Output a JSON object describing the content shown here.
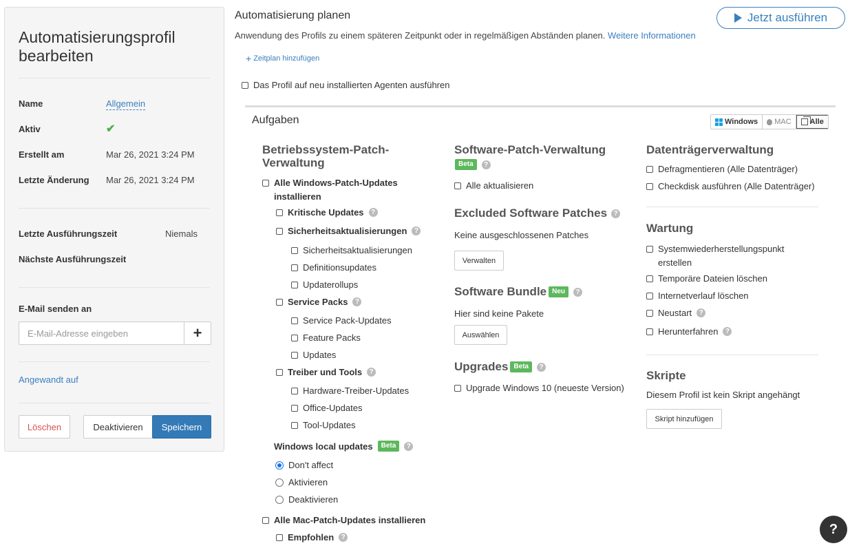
{
  "profile": {
    "title": "Automatisierungsprofil bearbeiten",
    "name_label": "Name",
    "name_value": "Allgemein",
    "active_label": "Aktiv",
    "active_mark": "✔",
    "created_label": "Erstellt am",
    "created_value": "Mar 26, 2021 3:24 PM",
    "modified_label": "Letzte Änderung",
    "modified_value": "Mar 26, 2021 3:24 PM",
    "last_run_label": "Letzte Ausführungszeit",
    "last_run_value": "Niemals",
    "next_run_label": "Nächste Ausführungszeit",
    "email_label": "E-Mail senden an",
    "email_placeholder": "E-Mail-Adresse eingeben",
    "email_add": "+",
    "applied_link": "Angewandt auf",
    "delete_label": "Löschen",
    "deactivate_label": "Deaktivieren",
    "save_label": "Speichern"
  },
  "schedule": {
    "title": "Automatisierung planen",
    "description": "Anwendung des Profils zu einem späteren Zeitpunkt oder in regelmäßigen Abständen planen.",
    "more_info": "Weitere Informationen",
    "run_now": "Jetzt ausführen",
    "add_schedule": "Zeitplan hinzufügen",
    "run_on_new_agents": "Das Profil auf neu installierten Agenten ausführen"
  },
  "tasks": {
    "title": "Aufgaben",
    "os_filter": {
      "windows": "Windows",
      "mac": "MAC",
      "all": "Alle"
    },
    "os_patch": {
      "title": "Betriebssystem-Patch-Verwaltung",
      "all_windows": "Alle Windows-Patch-Updates installieren",
      "critical": "Kritische Updates",
      "security": "Sicherheitsaktualisierungen",
      "security_sub": "Sicherheitsaktualisierungen",
      "definition": "Definitionsupdates",
      "rollups": "Updaterollups",
      "service_packs": "Service Packs",
      "sp_updates": "Service Pack-Updates",
      "feature_packs": "Feature Packs",
      "updates": "Updates",
      "drivers_tools": "Treiber und Tools",
      "hw_drivers": "Hardware-Treiber-Updates",
      "office": "Office-Updates",
      "tool_updates": "Tool-Updates",
      "local_updates": "Windows local updates",
      "local_badge": "Beta",
      "dont_affect": "Don't affect",
      "activate": "Aktivieren",
      "deactivate": "Deaktivieren",
      "all_mac": "Alle Mac-Patch-Updates installieren",
      "recommended": "Empfohlen"
    },
    "software_patch": {
      "title": "Software-Patch-Verwaltung",
      "badge": "Beta",
      "update_all": "Alle aktualisieren",
      "excluded_title": "Excluded Software Patches",
      "excluded_none": "Keine ausgeschlossenen Patches",
      "manage": "Verwalten",
      "bundle_title": "Software Bundle",
      "bundle_badge": "Neu",
      "bundle_none": "Hier sind keine Pakete",
      "select": "Auswählen",
      "upgrades_title": "Upgrades",
      "upgrades_badge": "Beta",
      "upgrade_win10": "Upgrade Windows 10 (neueste Version)"
    },
    "disk": {
      "title": "Datenträgerverwaltung",
      "defrag": "Defragmentieren (Alle Datenträger)",
      "checkdisk": "Checkdisk ausführen (Alle Datenträger)"
    },
    "maintenance": {
      "title": "Wartung",
      "restore_point": "Systemwiederherstellungspunkt erstellen",
      "temp_files": "Temporäre Dateien löschen",
      "history": "Internetverlauf löschen",
      "restart": "Neustart",
      "shutdown": "Herunterfahren"
    },
    "scripts": {
      "title": "Skripte",
      "none": "Diesem Profil ist kein Skript angehängt",
      "add": "Skript hinzufügen"
    }
  },
  "help": "?"
}
